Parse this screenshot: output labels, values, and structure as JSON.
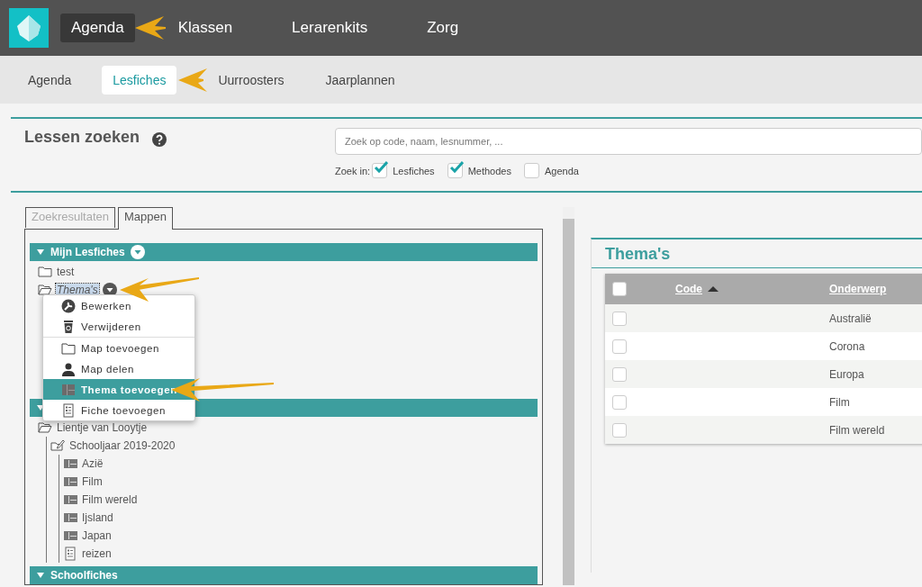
{
  "top_nav": {
    "items": [
      {
        "label": "Agenda",
        "selected": true
      },
      {
        "label": "Klassen",
        "selected": false
      },
      {
        "label": "Lerarenkits",
        "selected": false
      },
      {
        "label": "Zorg",
        "selected": false
      }
    ]
  },
  "sub_nav": {
    "items": [
      {
        "label": "Agenda",
        "selected": false
      },
      {
        "label": "Lesfiches",
        "selected": true
      },
      {
        "label": "Uurroosters",
        "selected": false
      },
      {
        "label": "Jaarplannen",
        "selected": false
      }
    ]
  },
  "search": {
    "title": "Lessen zoeken",
    "placeholder": "Zoek op code, naam, lesnummer, ...",
    "scope_label": "Zoek in:",
    "options": [
      {
        "label": "Lesfiches",
        "checked": true
      },
      {
        "label": "Methodes",
        "checked": true
      },
      {
        "label": "Agenda",
        "checked": false
      }
    ]
  },
  "panel_tabs": [
    {
      "label": "Zoekresultaten",
      "selected": false
    },
    {
      "label": "Mappen",
      "selected": true
    }
  ],
  "tree": [
    {
      "title": "Mijn Lesfiches",
      "expanded": true,
      "menu_button": true,
      "children": [
        {
          "label": "test",
          "kind": "folder",
          "selected": false
        },
        {
          "label": "Thema's",
          "kind": "folder-open",
          "selected": true,
          "menu_button": true
        }
      ]
    },
    {
      "expanded": true,
      "menu_button": false,
      "children": [
        {
          "label": "Lientje van Looytje",
          "kind": "folder-open",
          "selected": false,
          "children": [
            {
              "label": "Schooljaar 2019-2020",
              "kind": "folder-edit",
              "selected": false,
              "children": [
                {
                  "label": "Azië",
                  "kind": "theme",
                  "selected": false
                },
                {
                  "label": "Film",
                  "kind": "theme",
                  "selected": false
                },
                {
                  "label": "Film wereld",
                  "kind": "theme",
                  "selected": false
                },
                {
                  "label": "Ijsland",
                  "kind": "theme",
                  "selected": false
                },
                {
                  "label": "Japan",
                  "kind": "theme",
                  "selected": false
                },
                {
                  "label": "reizen",
                  "kind": "fiche",
                  "selected": false
                }
              ]
            }
          ]
        }
      ]
    },
    {
      "title": "Schoolfiches",
      "expanded": true,
      "menu_button": false
    }
  ],
  "context_menu": {
    "items": [
      {
        "label": "Bewerken",
        "kind": "edit",
        "selected": false,
        "divider_before": false
      },
      {
        "label": "Verwijderen",
        "kind": "delete",
        "selected": false,
        "divider_before": false
      },
      {
        "label": "Map toevoegen",
        "kind": "folder",
        "selected": false,
        "divider_before": true
      },
      {
        "label": "Map delen",
        "kind": "share",
        "selected": false,
        "divider_before": false
      },
      {
        "label": "Thema toevoegen",
        "kind": "theme",
        "selected": true,
        "divider_before": false
      },
      {
        "label": "Fiche toevoegen",
        "kind": "fiche",
        "selected": false,
        "divider_before": false
      }
    ]
  },
  "themes_card": {
    "title": "Thema's",
    "columns": [
      {
        "label": "Code",
        "sorted": true
      },
      {
        "label": "Onderwerp",
        "sorted": false
      }
    ],
    "select_all_checked": false,
    "rows": [
      {
        "checked": false,
        "onderwerp": "Australië"
      },
      {
        "checked": false,
        "onderwerp": "Corona"
      },
      {
        "checked": false,
        "onderwerp": "Europa"
      },
      {
        "checked": false,
        "onderwerp": "Film"
      },
      {
        "checked": false,
        "onderwerp": "Film wereld"
      }
    ]
  },
  "callouts": [
    {
      "kind": "arrow"
    },
    {
      "kind": "arrow"
    },
    {
      "kind": "arrow"
    },
    {
      "kind": "arrow"
    }
  ]
}
